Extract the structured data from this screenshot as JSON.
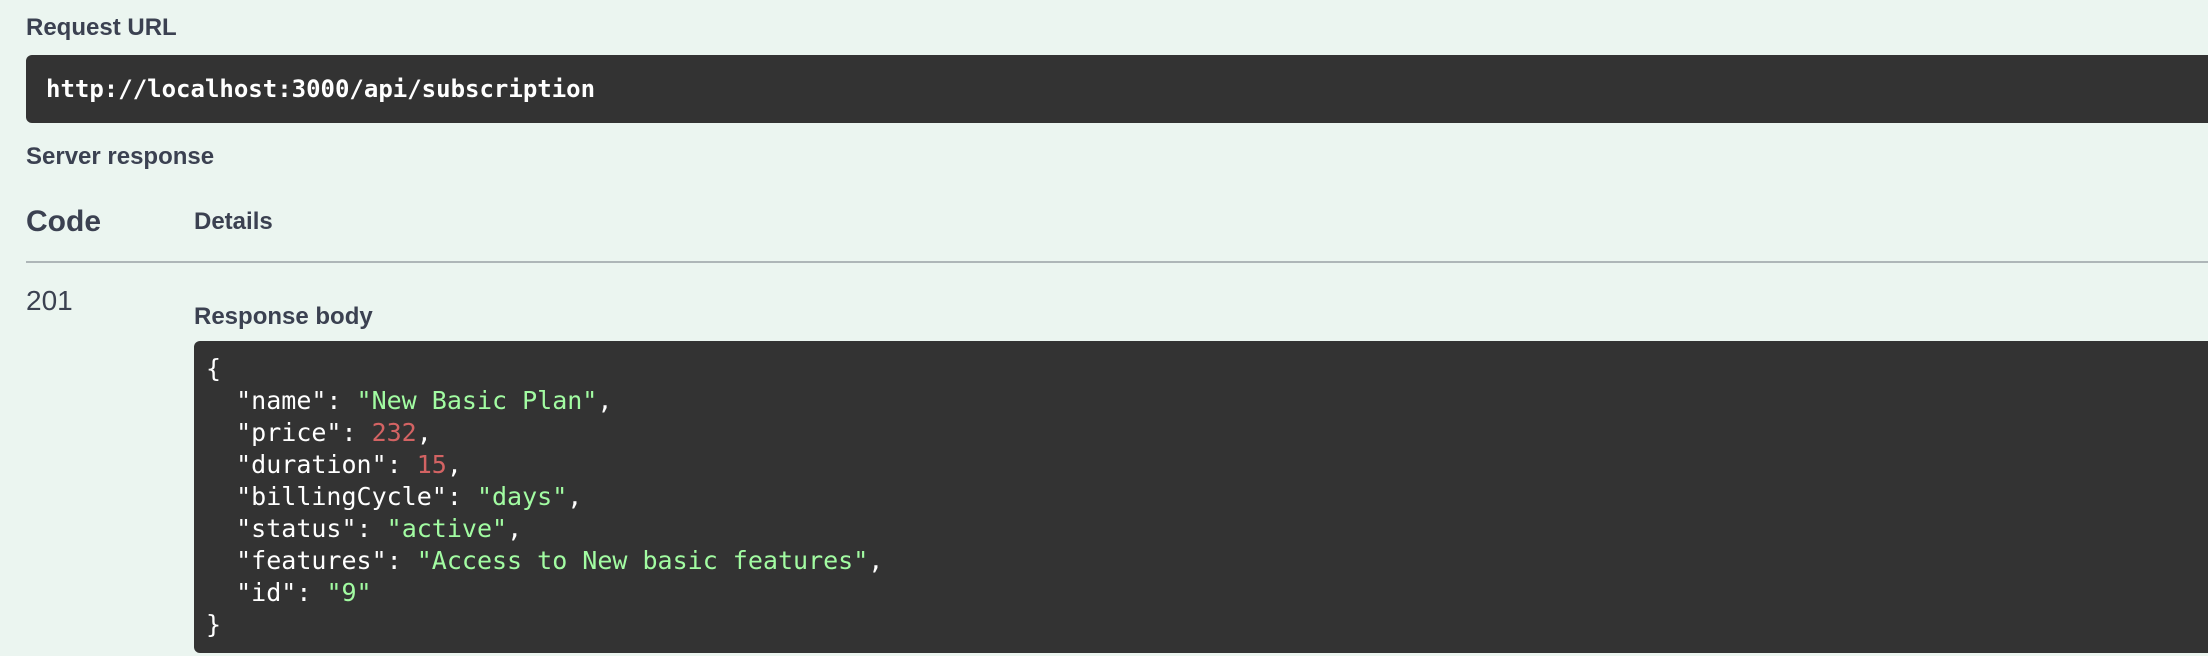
{
  "request_url": {
    "label": "Request URL",
    "value": "http://localhost:3000/api/subscription"
  },
  "server_response": {
    "label": "Server response",
    "columns": {
      "code": "Code",
      "details": "Details"
    },
    "status_code": "201",
    "response_body_label": "Response body",
    "body": {
      "open_brace": "{",
      "close_brace": "}",
      "entries": [
        {
          "key": "\"name\"",
          "value": "\"New Basic Plan\"",
          "kind": "string"
        },
        {
          "key": "\"price\"",
          "value": "232",
          "kind": "number"
        },
        {
          "key": "\"duration\"",
          "value": "15",
          "kind": "number"
        },
        {
          "key": "\"billingCycle\"",
          "value": "\"days\"",
          "kind": "string"
        },
        {
          "key": "\"status\"",
          "value": "\"active\"",
          "kind": "string"
        },
        {
          "key": "\"features\"",
          "value": "\"Access to New basic features\"",
          "kind": "string"
        },
        {
          "key": "\"id\"",
          "value": "\"9\"",
          "kind": "string"
        }
      ]
    }
  },
  "colors": {
    "background": "#ebf5f0",
    "code_background": "#333333",
    "string_token": "#a2fca2",
    "number_token": "#d36363",
    "text": "#3b4151"
  }
}
